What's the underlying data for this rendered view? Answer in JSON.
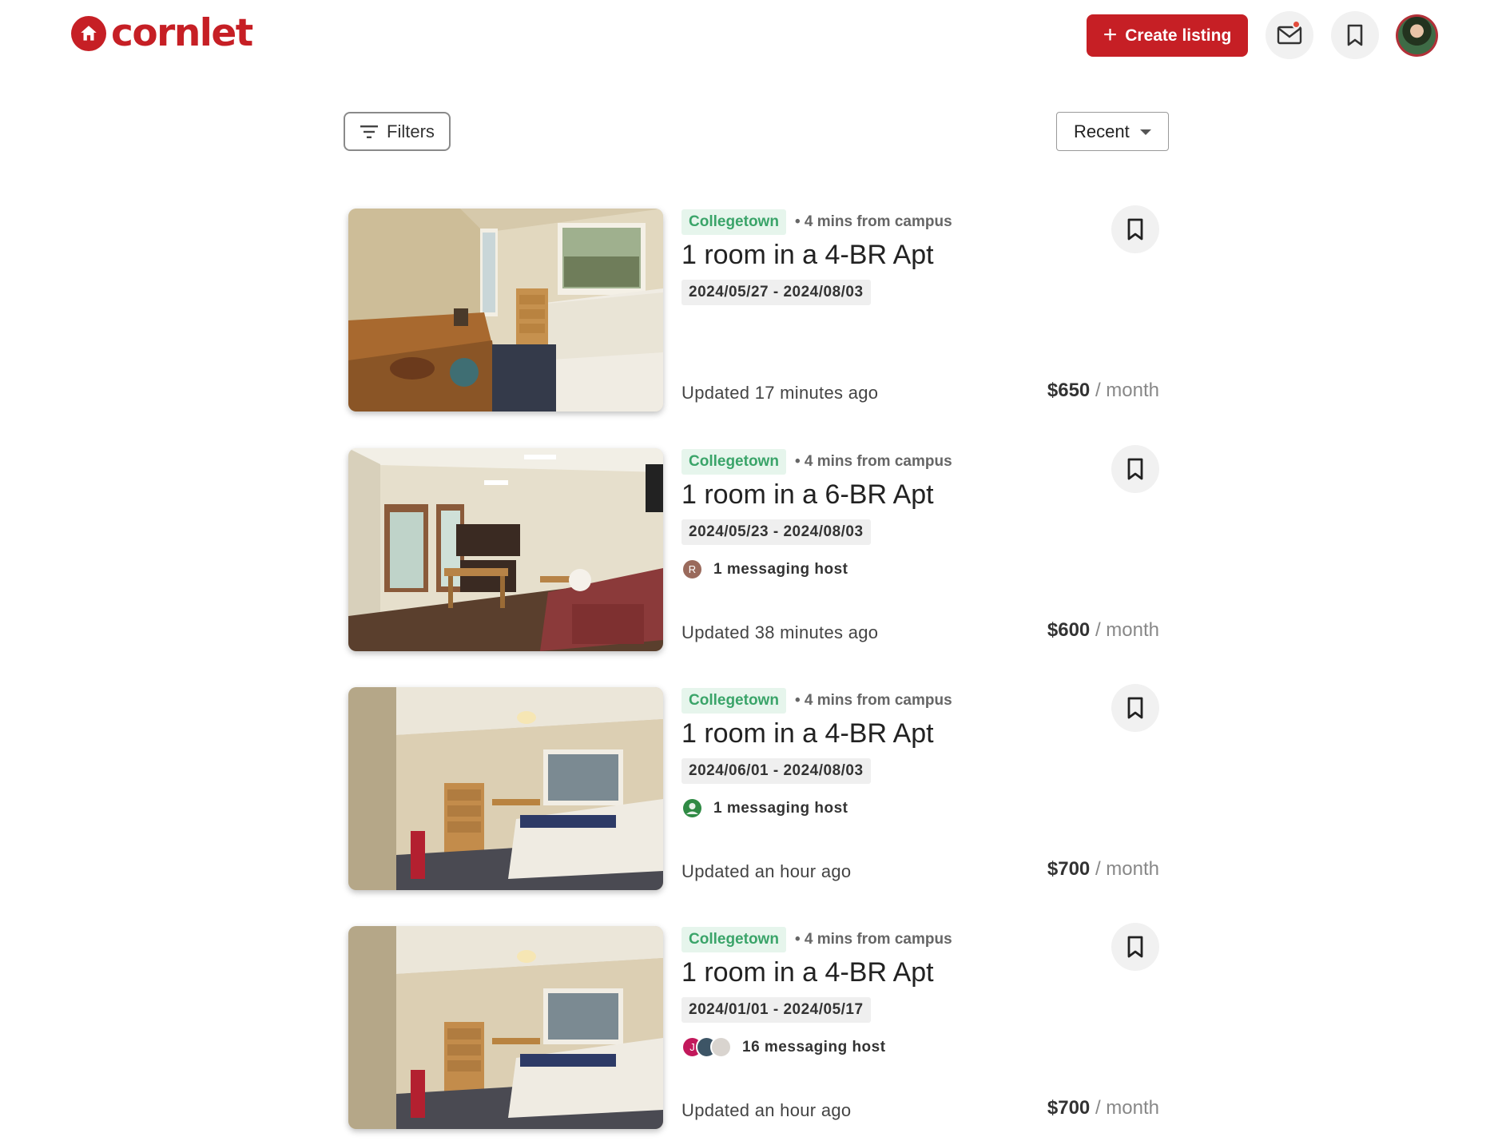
{
  "brand": {
    "name": "cornlet",
    "color": "#c61f25"
  },
  "header": {
    "create_label": "Create listing",
    "mail_icon": "mail-icon",
    "saved_icon": "bookmark-icon",
    "has_unread": true
  },
  "toolbar": {
    "filters_label": "Filters",
    "sort_value": "Recent"
  },
  "listings": [
    {
      "tag": "Collegetown",
      "distance": "• 4 mins from campus",
      "title": "1 room in a 4-BR Apt",
      "dates": "2024/05/27 - 2024/08/03",
      "hosts_text": "",
      "updated": "Updated 17 minutes ago",
      "price": "$650",
      "price_unit": " / month"
    },
    {
      "tag": "Collegetown",
      "distance": "• 4 mins from campus",
      "title": "1 room in a 6-BR Apt",
      "dates": "2024/05/23 - 2024/08/03",
      "hosts_text": "1 messaging host",
      "host_avatars": [
        "R"
      ],
      "updated": "Updated 38 minutes ago",
      "price": "$600",
      "price_unit": " / month"
    },
    {
      "tag": "Collegetown",
      "distance": "• 4 mins from campus",
      "title": "1 room in a 4-BR Apt",
      "dates": "2024/06/01 - 2024/08/03",
      "hosts_text": "1 messaging host",
      "updated": "Updated an hour ago",
      "price": "$700",
      "price_unit": " / month"
    },
    {
      "tag": "Collegetown",
      "distance": "• 4 mins from campus",
      "title": "1 room in a 4-BR Apt",
      "dates": "2024/01/01 - 2024/05/17",
      "hosts_text": "16 messaging host",
      "host_avatars": [
        "J"
      ],
      "updated": "Updated an hour ago",
      "price": "$700",
      "price_unit": " / month"
    }
  ]
}
